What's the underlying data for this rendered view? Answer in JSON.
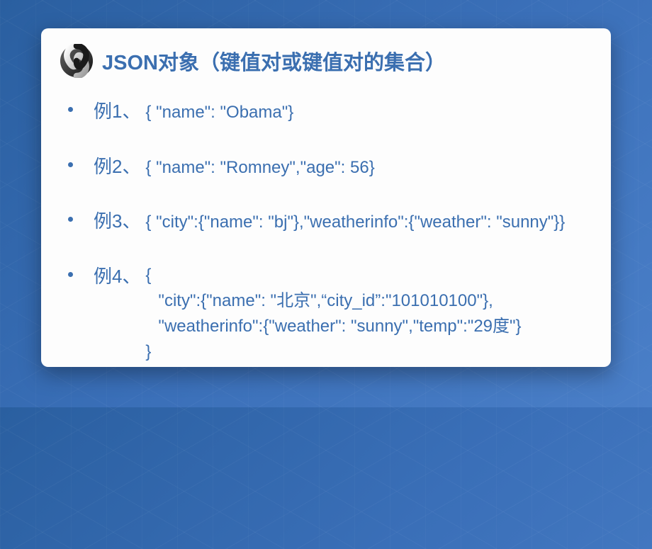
{
  "title": "JSON对象（键值对或键值对的集合）",
  "examples": [
    {
      "label": "例1、",
      "code": "{ \"name\": \"Obama\"}"
    },
    {
      "label": "例2、",
      "code": "{ \"name\": \"Romney\",\"age\": 56}"
    },
    {
      "label": "例3、",
      "code": "{ \"city\":{\"name\": \"bj\"},\"weatherinfo\":{\"weather\": \"sunny\"}}"
    },
    {
      "label": "例4、",
      "block": {
        "open": "{",
        "lines": [
          "\"city\":{\"name\": \"北京\",“city_id”:\"101010100\"},",
          "\"weatherinfo\":{\"weather\": \"sunny\",\"temp\":\"29度\"}"
        ],
        "close": "}"
      }
    }
  ]
}
